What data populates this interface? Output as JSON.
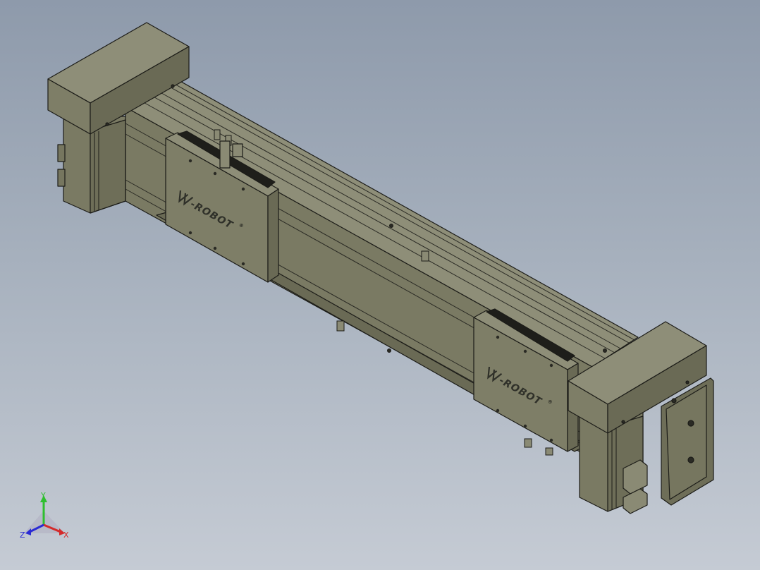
{
  "model": {
    "brand_text": "-ROBOT",
    "brand_mark_suffix": "®"
  },
  "triad": {
    "x_label": "X",
    "y_label": "Y",
    "z_label": "Z",
    "x_color": "#d42a2a",
    "y_color": "#2fbf2f",
    "z_color": "#2a2ad4"
  },
  "colors": {
    "body_light": "#8a8a74",
    "body_mid": "#76765f",
    "body_dark": "#5b5b47",
    "edge": "#1c1c18"
  }
}
